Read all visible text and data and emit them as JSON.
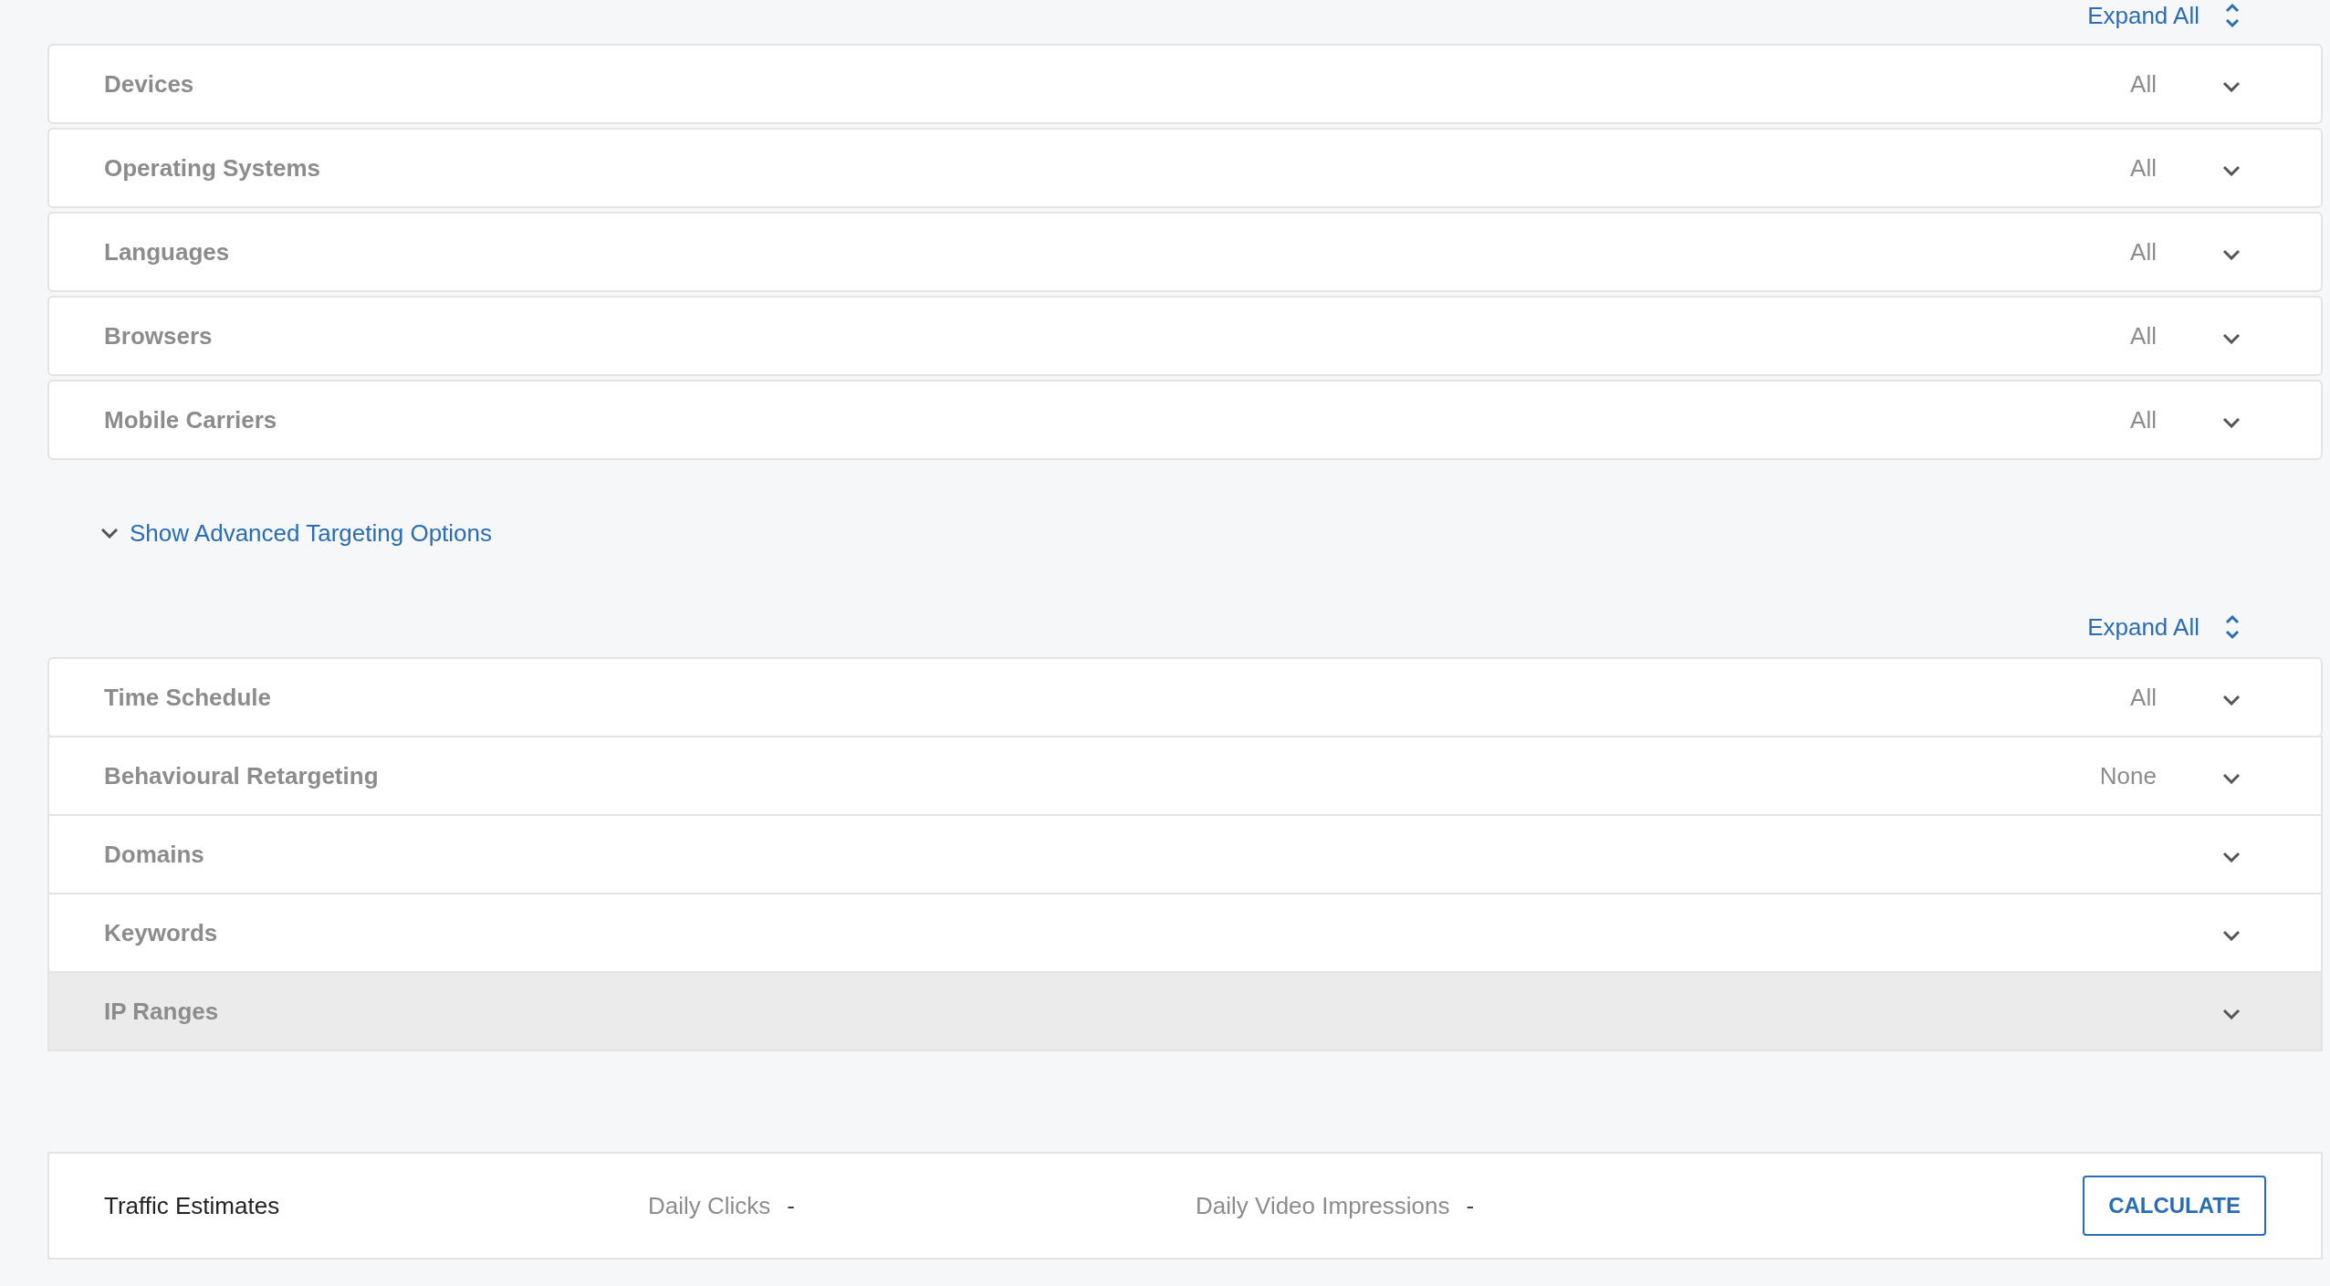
{
  "basic_targeting": {
    "expand_all": "Expand All",
    "rows": [
      {
        "label": "Devices",
        "value": "All",
        "highlighted": false
      },
      {
        "label": "Operating Systems",
        "value": "All",
        "highlighted": false
      },
      {
        "label": "Languages",
        "value": "All",
        "highlighted": false
      },
      {
        "label": "Browsers",
        "value": "All",
        "highlighted": false
      },
      {
        "label": "Mobile Carriers",
        "value": "All",
        "highlighted": false
      }
    ]
  },
  "advanced_toggle": "Show Advanced Targeting Options",
  "advanced_targeting": {
    "expand_all": "Expand All",
    "rows": [
      {
        "label": "Time Schedule",
        "value": "All",
        "highlighted": false
      },
      {
        "label": "Behavioural Retargeting",
        "value": "None",
        "highlighted": false
      },
      {
        "label": "Domains",
        "highlighted": false
      },
      {
        "label": "Keywords",
        "highlighted": false
      },
      {
        "label": "IP Ranges",
        "highlighted": true
      }
    ]
  },
  "traffic_estimates": {
    "title": "Traffic Estimates",
    "daily_clicks_label": "Daily Clicks",
    "daily_clicks": "-",
    "daily_video_impressions_label": "Daily Video Impressions",
    "daily_video_impressions": "-",
    "button": "CALCULATE"
  }
}
